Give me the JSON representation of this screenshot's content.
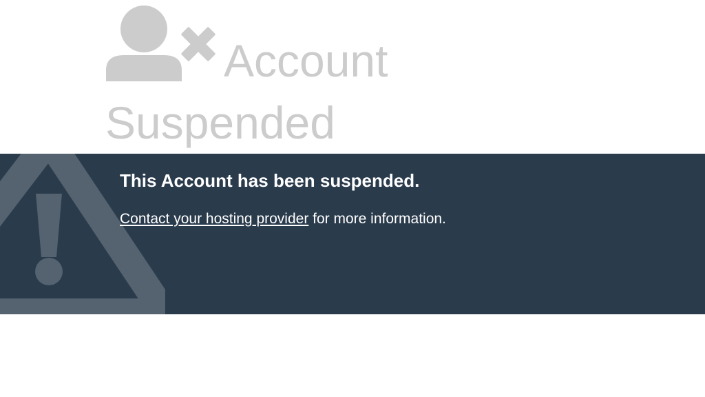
{
  "header": {
    "title_word1": "Account",
    "title_word2": "Suspended",
    "icon": "user-remove-icon"
  },
  "banner": {
    "icon": "warning-triangle-icon",
    "title": "This Account has been suspended.",
    "contact_link": "Contact your hosting provider",
    "contact_suffix": " for more information."
  },
  "colors": {
    "heading_gray": "#cccccc",
    "banner_bg": "#2a3b4c",
    "warning_icon": "#55626f",
    "text": "#ffffff"
  }
}
